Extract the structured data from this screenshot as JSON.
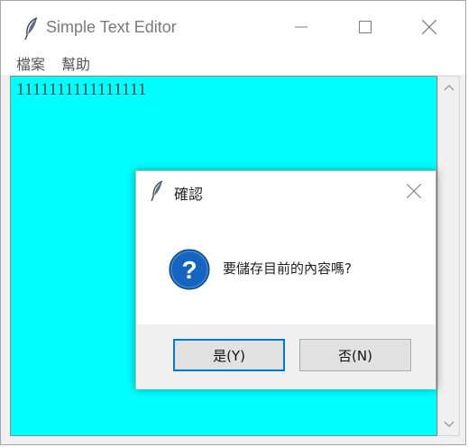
{
  "window": {
    "title": "Simple Text Editor"
  },
  "menu": {
    "items": [
      {
        "label": "檔案"
      },
      {
        "label": "幫助"
      }
    ]
  },
  "editor": {
    "content": "1111111111111111",
    "background": "#00ffff"
  },
  "dialog": {
    "title": "確認",
    "message": "要儲存目前的內容嗎?",
    "icon": "question-icon",
    "yes_label": "是(Y)",
    "no_label": "否(N)"
  },
  "colors": {
    "accent": "#0078d7",
    "question_icon": "#1565c0"
  }
}
